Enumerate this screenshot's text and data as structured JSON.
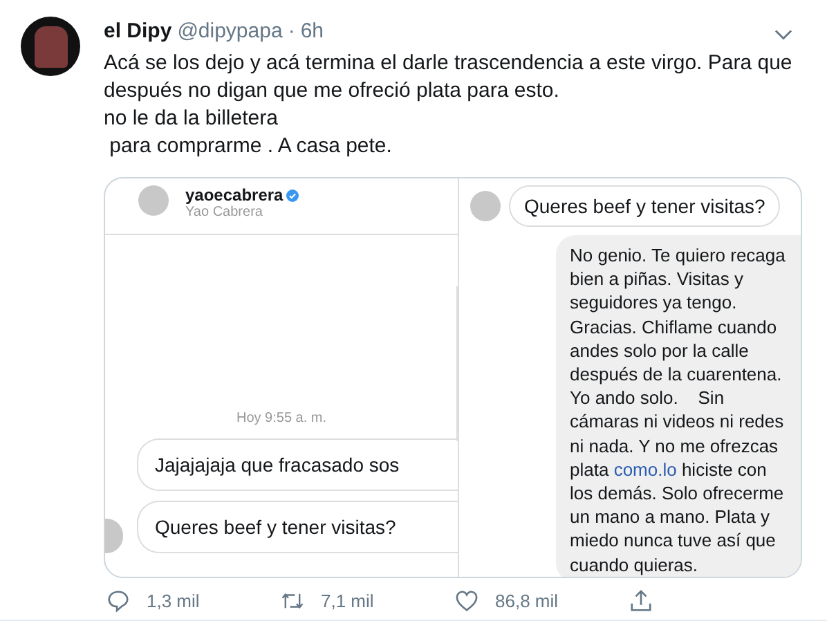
{
  "tweet": {
    "name": "el Dipy",
    "handle": "@dipypapa",
    "separator": "·",
    "time": "6h",
    "text_lines": [
      "Acá se los dejo y acá termina el darle trascendencia a este virgo. Para que después no digan que me ofreció plata para esto.",
      "no le da la billetera",
      " para comprarme . A casa pete."
    ]
  },
  "left_image": {
    "username": "yaoecabrera",
    "full_name": "Yao Cabrera",
    "timestamp": "Hoy 9:55 a. m.",
    "messages": [
      "Jajajajaja que fracasado sos",
      "Queres beef y tener visitas?"
    ]
  },
  "right_image": {
    "incoming": "Queres beef y tener visitas?",
    "reply_lines": [
      {
        "text": "No genio. Te quiero recaga"
      },
      {
        "text": "bien a piñas. Visitas y"
      },
      {
        "text": "seguidores ya tengo."
      },
      {
        "text": "Gracias. Chiflame cuando"
      },
      {
        "text": "andes solo por la calle"
      },
      {
        "text": "después de la cuarentena."
      },
      {
        "text": "Yo ando solo.    Sin"
      },
      {
        "text": "cámaras ni videos ni redes"
      },
      {
        "text": "ni nada. Y no me ofrezcas"
      },
      {
        "text": "plata ",
        "link": "como.lo",
        "after": " hiciste con"
      },
      {
        "text": "los demás. Solo ofrecerme"
      },
      {
        "text": "un mano a mano. Plata y"
      },
      {
        "text": "miedo nunca tuve así que"
      },
      {
        "text": "cuando quieras."
      }
    ]
  },
  "actions": [
    {
      "kind": "reply",
      "count": "1,3 mil"
    },
    {
      "kind": "retweet",
      "count": "7,1 mil"
    },
    {
      "kind": "like",
      "count": "86,8 mil"
    },
    {
      "kind": "share"
    }
  ]
}
